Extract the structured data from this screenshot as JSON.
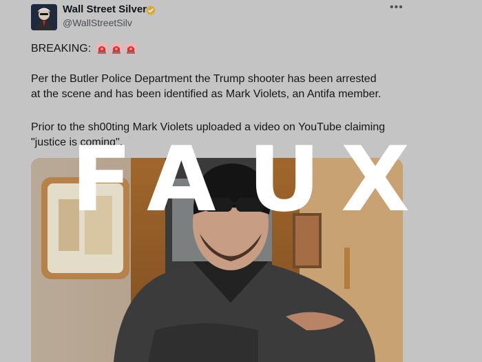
{
  "author": {
    "name": "Wall Street Silver",
    "handle": "@WallStreetSilv",
    "verified_color": "#e3b341"
  },
  "tweet": {
    "breaking_label": "BREAKING:",
    "line1": "Per the Butler Police Department the Trump shooter has been arrested",
    "line2": "at the scene and has been identified as Mark Violets, an Antifa member.",
    "line3": "Prior to the sh00ting Mark Violets uploaded a video on YouTube claiming",
    "line4": "\"justice is coming\"."
  },
  "icons": {
    "more": "more-options-icon",
    "siren": "police-siren-emoji"
  },
  "more_glyph": "•••",
  "watermark": {
    "letters": [
      "F",
      "A",
      "U",
      "X"
    ]
  }
}
